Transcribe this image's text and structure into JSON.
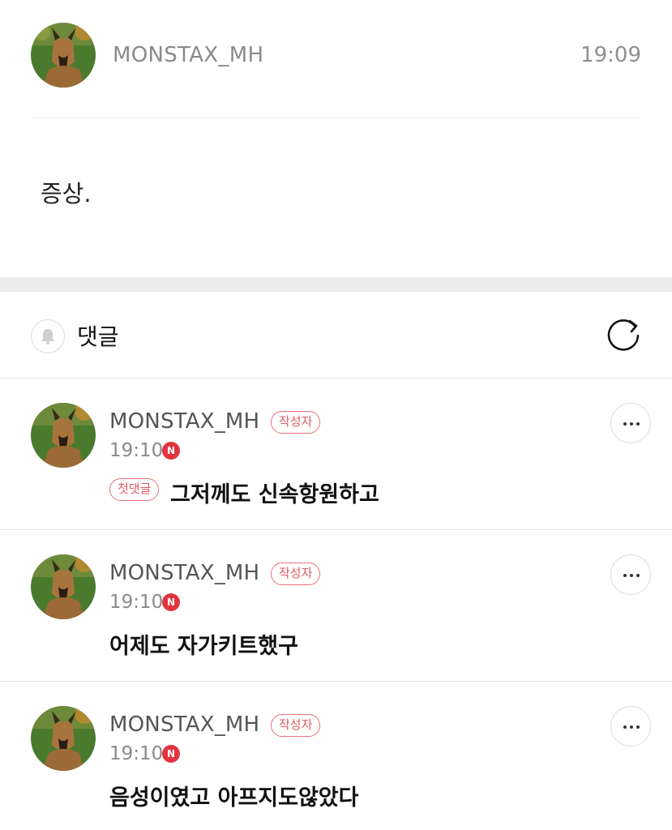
{
  "post": {
    "author": "MONSTAX_MH",
    "time": "19:09",
    "body": "증상."
  },
  "comments_header": {
    "title": "댓글"
  },
  "badges": {
    "writer": "작성자",
    "first_comment": "첫댓글",
    "new": "N"
  },
  "comments": [
    {
      "author": "MONSTAX_MH",
      "time": "19:10",
      "text": "그저께도 신속항원하고",
      "first": true
    },
    {
      "author": "MONSTAX_MH",
      "time": "19:10",
      "text": "어제도 자가키트했구",
      "first": false
    },
    {
      "author": "MONSTAX_MH",
      "time": "19:10",
      "text": "음성이였고 아프지도않았다",
      "first": false
    }
  ],
  "colors": {
    "accent_red": "#e2343f",
    "badge_border": "#e8727a",
    "divider": "#e6e6e6",
    "section_gap": "#ececec"
  },
  "icons": [
    "dog-avatar",
    "bell-icon",
    "refresh-icon",
    "more-icon",
    "new-badge-icon"
  ]
}
